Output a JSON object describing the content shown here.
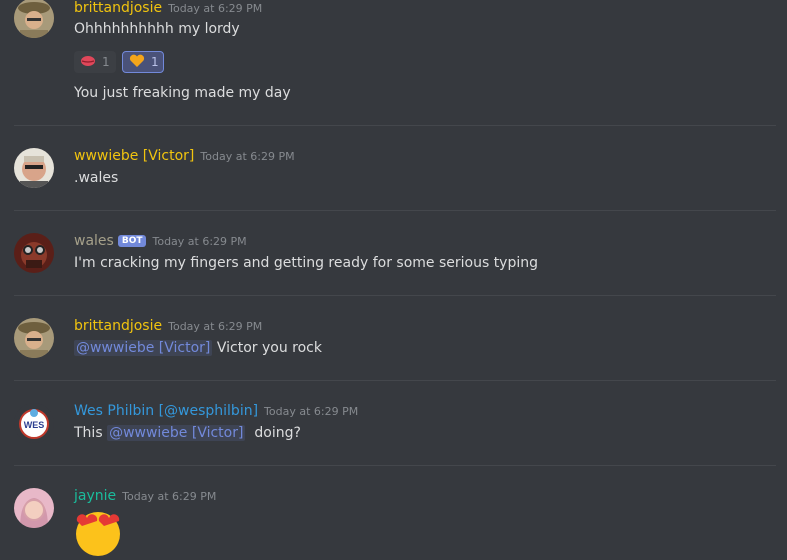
{
  "messages": [
    {
      "username": "brittandjosie",
      "color": "#f1c40f",
      "timestamp": "Today at 6:29 PM",
      "lines": [
        "Ohhhhhhhhhh my lordy",
        "You just freaking made my day"
      ],
      "reactions": [
        {
          "emoji": "lips-icon",
          "count": "1"
        },
        {
          "emoji": "orange-heart-icon",
          "count": "1"
        }
      ]
    },
    {
      "username": "wwwiebe [Victor]",
      "color": "#f1c40f",
      "timestamp": "Today at 6:29 PM",
      "text": ".wales"
    },
    {
      "username": "wales",
      "color": "#a5a08a",
      "badge": "BOT",
      "timestamp": "Today at 6:29 PM",
      "text": "I'm cracking my fingers and getting ready for some serious typing"
    },
    {
      "username": "brittandjosie",
      "color": "#f1c40f",
      "timestamp": "Today at 6:29 PM",
      "mention": "@wwwiebe [Victor]",
      "text_after": " Victor you rock"
    },
    {
      "username": "Wes Philbin [@wesphilbin]",
      "color": "#3498db",
      "timestamp": "Today at 6:29 PM",
      "text_before": "This ",
      "mention": "@wwwiebe [Victor]",
      "text_after": "  doing?"
    },
    {
      "username": "jaynie",
      "color": "#1abc9c",
      "timestamp": "Today at 6:29 PM",
      "emoji": "heart-eyes-emoji"
    }
  ]
}
